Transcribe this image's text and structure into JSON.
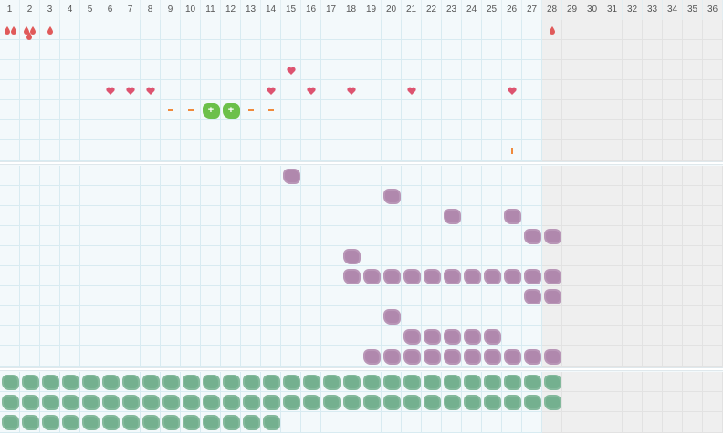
{
  "grid": {
    "columns": [
      "1",
      "2",
      "3",
      "4",
      "5",
      "6",
      "7",
      "8",
      "9",
      "10",
      "11",
      "12",
      "13",
      "14",
      "15",
      "16",
      "17",
      "18",
      "19",
      "20",
      "21",
      "22",
      "23",
      "24",
      "25",
      "26",
      "27",
      "28",
      "29",
      "30",
      "31",
      "32",
      "33",
      "34",
      "35",
      "36"
    ],
    "shaded_from_column": 28,
    "row_counts": [
      7,
      10,
      3
    ]
  },
  "icons": {
    "drop": "drop-icon",
    "drops": "drops-icon",
    "heart": "heart-icon",
    "dash": "dash-icon",
    "plus_blob": "plus-blob-icon",
    "tick": "tick-icon",
    "purple_blob": "purple-blob-icon",
    "teal_blob": "teal-blob-icon"
  },
  "colors": {
    "drop": "#e05a5a",
    "heart": "#dd5470",
    "dash": "#f08a3c",
    "green": "#6cc04a",
    "purple": "#b088ad",
    "teal": "#74b08f"
  },
  "top_marks": [
    {
      "type": "drops2",
      "col": 1,
      "row": 1
    },
    {
      "type": "drops3",
      "col": 2,
      "row": 1
    },
    {
      "type": "drop",
      "col": 3,
      "row": 1
    },
    {
      "type": "drop",
      "col": 28,
      "row": 1
    },
    {
      "type": "heart",
      "col": 15,
      "row": 3
    },
    {
      "type": "heart",
      "col": 6,
      "row": 4
    },
    {
      "type": "heart",
      "col": 7,
      "row": 4
    },
    {
      "type": "heart",
      "col": 8,
      "row": 4
    },
    {
      "type": "heart",
      "col": 14,
      "row": 4
    },
    {
      "type": "heart",
      "col": 16,
      "row": 4
    },
    {
      "type": "heart",
      "col": 18,
      "row": 4
    },
    {
      "type": "heart",
      "col": 21,
      "row": 4
    },
    {
      "type": "heart",
      "col": 26,
      "row": 4
    },
    {
      "type": "dash",
      "col": 9,
      "row": 5
    },
    {
      "type": "dash",
      "col": 10,
      "row": 5
    },
    {
      "type": "plus",
      "col": 11,
      "row": 5
    },
    {
      "type": "plus",
      "col": 12,
      "row": 5
    },
    {
      "type": "dash",
      "col": 13,
      "row": 5
    },
    {
      "type": "dash",
      "col": 14,
      "row": 5
    },
    {
      "type": "tick",
      "col": 26,
      "row": 7
    }
  ],
  "middle_rows": [
    {
      "row": 1,
      "cols": [
        15
      ]
    },
    {
      "row": 2,
      "cols": [
        20
      ]
    },
    {
      "row": 3,
      "cols": [
        23,
        26
      ]
    },
    {
      "row": 4,
      "cols": [
        27,
        28
      ]
    },
    {
      "row": 5,
      "cols": [
        18
      ]
    },
    {
      "row": 6,
      "cols": [
        18,
        19,
        20,
        21,
        22,
        23,
        24,
        25,
        26,
        27,
        28
      ]
    },
    {
      "row": 7,
      "cols": [
        27,
        28
      ]
    },
    {
      "row": 8,
      "cols": [
        20
      ]
    },
    {
      "row": 9,
      "cols": [
        21,
        22,
        23,
        24,
        25
      ]
    },
    {
      "row": 10,
      "cols": [
        19,
        20,
        21,
        22,
        23,
        24,
        25,
        26,
        27,
        28
      ]
    }
  ],
  "bottom_rows": [
    {
      "row": 1,
      "from": 1,
      "to": 28
    },
    {
      "row": 2,
      "from": 1,
      "to": 28
    },
    {
      "row": 3,
      "from": 1,
      "to": 14
    }
  ]
}
